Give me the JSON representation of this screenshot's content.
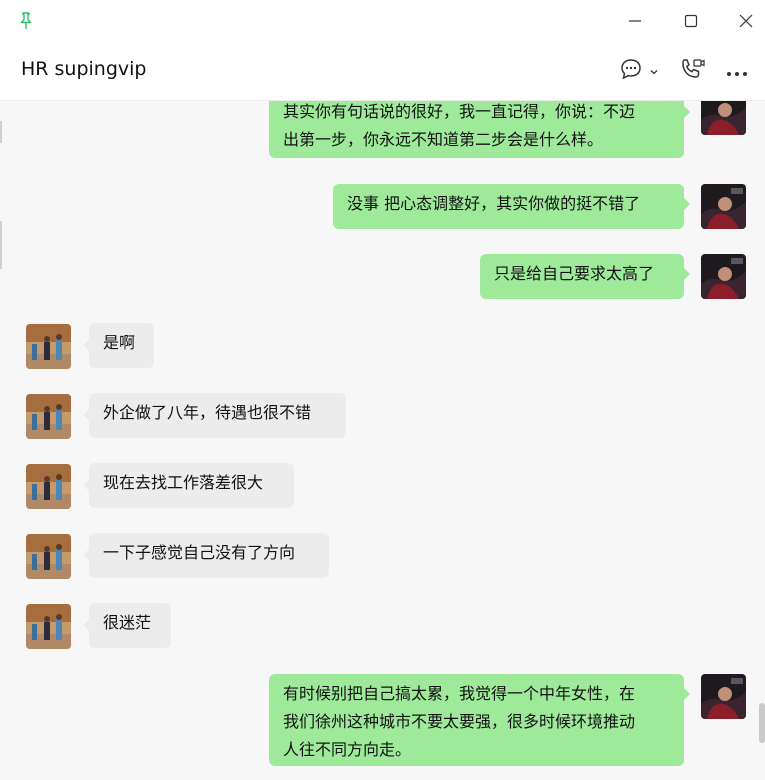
{
  "window": {
    "title": "HR supingvip",
    "pin_icon": "pin-icon",
    "controls": [
      "minimize-icon",
      "maximize-icon",
      "close-icon"
    ]
  },
  "header": {
    "icons": [
      "chat-bubble-icon",
      "chevron-down-icon",
      "phone-video-icon",
      "more-icon"
    ]
  },
  "colors": {
    "my_bubble": "#9eea9a",
    "their_bubble": "#ececec",
    "pin": "#2fbf6a"
  },
  "messages": [
    {
      "from": "me",
      "text": "其实你有句话说的很好，我一直记得，你说：不迈\n出第一步，你永远不知道第二步会是什么样。"
    },
    {
      "from": "me",
      "text": "没事 把心态调整好，其实你做的挺不错了"
    },
    {
      "from": "me",
      "text": "只是给自己要求太高了"
    },
    {
      "from": "other",
      "text": "是啊"
    },
    {
      "from": "other",
      "text": "外企做了八年，待遇也很不错"
    },
    {
      "from": "other",
      "text": "现在去找工作落差很大"
    },
    {
      "from": "other",
      "text": "一下子感觉自己没有了方向"
    },
    {
      "from": "other",
      "text": "很迷茫"
    },
    {
      "from": "me",
      "text": "有时候别把自己搞太累，我觉得一个中年女性，在\n我们徐州这种城市不要太要强，很多时候环境推动\n人往不同方向走。"
    }
  ]
}
